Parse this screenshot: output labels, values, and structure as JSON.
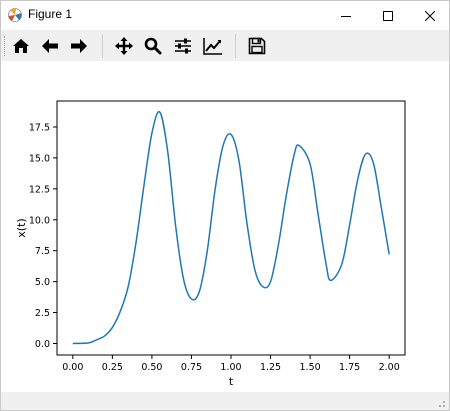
{
  "window": {
    "title": "Figure 1"
  },
  "toolbar": {
    "buttons": [
      {
        "name": "home-button",
        "icon": "home-icon"
      },
      {
        "name": "back-button",
        "icon": "arrow-left-icon"
      },
      {
        "name": "forward-button",
        "icon": "arrow-right-icon"
      },
      {
        "name": "pan-button",
        "icon": "move-icon"
      },
      {
        "name": "zoom-button",
        "icon": "magnifier-icon"
      },
      {
        "name": "configure-subplots-button",
        "icon": "sliders-icon"
      },
      {
        "name": "edit-axis-button",
        "icon": "line-chart-icon"
      },
      {
        "name": "save-button",
        "icon": "floppy-disk-icon"
      }
    ]
  },
  "chart_data": {
    "type": "line",
    "title": "",
    "xlabel": "t",
    "ylabel": "x(t)",
    "xlim": [
      -0.1,
      2.1
    ],
    "ylim": [
      -0.93,
      19.6
    ],
    "xticks": [
      "0.00",
      "0.25",
      "0.50",
      "0.75",
      "1.00",
      "1.25",
      "1.50",
      "1.75",
      "2.00"
    ],
    "yticks": [
      "0.0",
      "2.5",
      "5.0",
      "7.5",
      "10.0",
      "12.5",
      "15.0",
      "17.5"
    ],
    "grid": false,
    "series": [
      {
        "name": "",
        "color": "#1f77b4",
        "x": [
          0.0,
          0.1,
          0.15,
          0.2,
          0.25,
          0.3,
          0.35,
          0.4,
          0.45,
          0.5,
          0.55,
          0.6,
          0.65,
          0.7,
          0.75,
          0.8,
          0.85,
          0.9,
          0.95,
          1.0,
          1.05,
          1.1,
          1.15,
          1.2,
          1.25,
          1.3,
          1.35,
          1.4,
          1.43,
          1.5,
          1.55,
          1.6,
          1.63,
          1.7,
          1.75,
          1.8,
          1.85,
          1.9,
          1.95,
          2.0
        ],
        "y": [
          0.0,
          0.05,
          0.3,
          0.6,
          1.3,
          2.6,
          4.6,
          8.2,
          12.8,
          17.0,
          18.7,
          15.5,
          9.5,
          5.2,
          3.6,
          4.2,
          7.5,
          12.5,
          16.0,
          16.9,
          14.8,
          9.8,
          6.0,
          4.6,
          5.0,
          8.0,
          12.0,
          15.3,
          16.0,
          14.5,
          10.5,
          6.5,
          5.1,
          6.4,
          9.6,
          13.2,
          15.3,
          14.6,
          11.0,
          7.2
        ]
      }
    ]
  }
}
